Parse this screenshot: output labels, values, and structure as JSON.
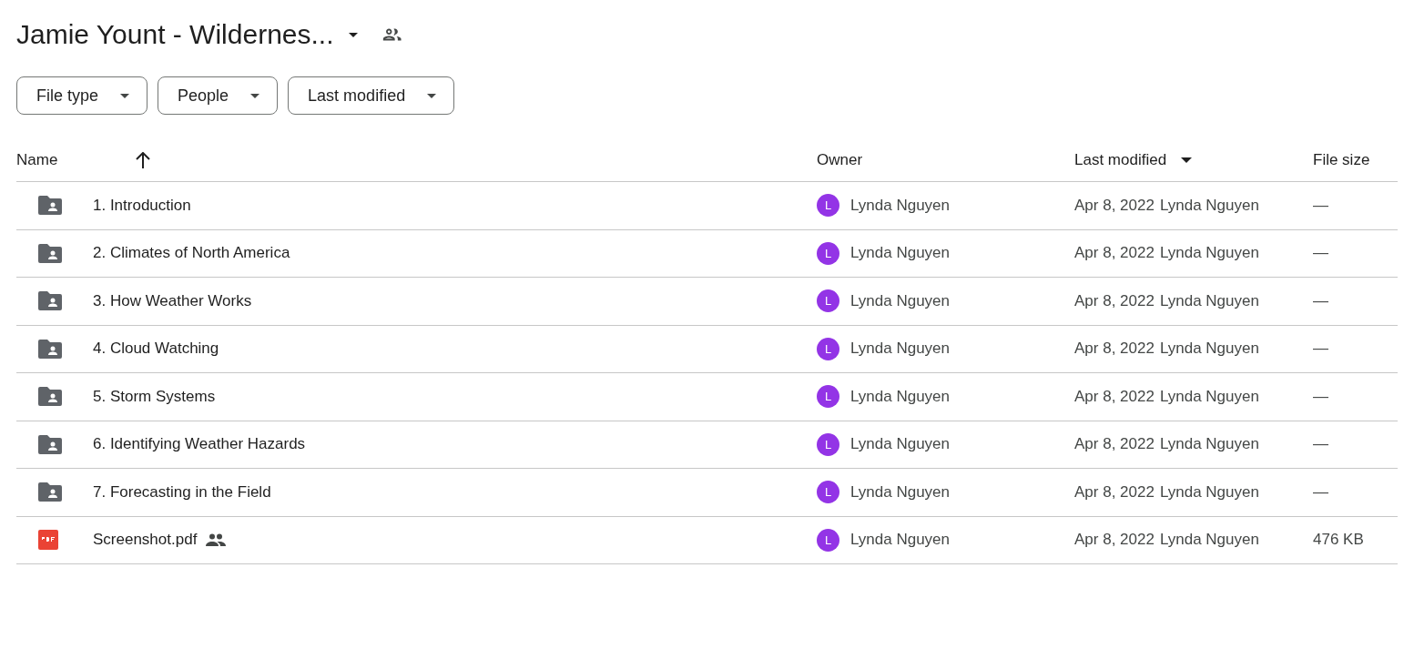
{
  "header": {
    "title": "Jamie Yount - Wildernes..."
  },
  "filters": [
    {
      "label": "File type"
    },
    {
      "label": "People"
    },
    {
      "label": "Last modified"
    }
  ],
  "table": {
    "columns": [
      {
        "label": "Name",
        "sort_up": true,
        "sort_down": false
      },
      {
        "label": "Owner",
        "sort_up": false,
        "sort_down": false
      },
      {
        "label": "Last modified",
        "sort_up": false,
        "sort_down": true
      },
      {
        "label": "File size",
        "sort_up": false,
        "sort_down": false
      }
    ],
    "rows": [
      {
        "kind": "folder",
        "name": "1. Introduction",
        "shared": false,
        "owner_avatar": "L",
        "owner": "Lynda Nguyen",
        "modified_date": "Apr 8, 2022",
        "modified_by": "Lynda Nguyen",
        "size": "—"
      },
      {
        "kind": "folder",
        "name": "2. Climates of North America",
        "shared": false,
        "owner_avatar": "L",
        "owner": "Lynda Nguyen",
        "modified_date": "Apr 8, 2022",
        "modified_by": "Lynda Nguyen",
        "size": "—"
      },
      {
        "kind": "folder",
        "name": "3. How Weather Works",
        "shared": false,
        "owner_avatar": "L",
        "owner": "Lynda Nguyen",
        "modified_date": "Apr 8, 2022",
        "modified_by": "Lynda Nguyen",
        "size": "—"
      },
      {
        "kind": "folder",
        "name": "4. Cloud Watching",
        "shared": false,
        "owner_avatar": "L",
        "owner": "Lynda Nguyen",
        "modified_date": "Apr 8, 2022",
        "modified_by": "Lynda Nguyen",
        "size": "—"
      },
      {
        "kind": "folder",
        "name": "5. Storm Systems",
        "shared": false,
        "owner_avatar": "L",
        "owner": "Lynda Nguyen",
        "modified_date": "Apr 8, 2022",
        "modified_by": "Lynda Nguyen",
        "size": "—"
      },
      {
        "kind": "folder",
        "name": "6. Identifying Weather Hazards",
        "shared": false,
        "owner_avatar": "L",
        "owner": "Lynda Nguyen",
        "modified_date": "Apr 8, 2022",
        "modified_by": "Lynda Nguyen",
        "size": "—"
      },
      {
        "kind": "folder",
        "name": "7. Forecasting in the Field",
        "shared": false,
        "owner_avatar": "L",
        "owner": "Lynda Nguyen",
        "modified_date": "Apr 8, 2022",
        "modified_by": "Lynda Nguyen",
        "size": "—"
      },
      {
        "kind": "pdf",
        "name": "Screenshot.pdf",
        "shared": true,
        "owner_avatar": "L",
        "owner": "Lynda Nguyen",
        "modified_date": "Apr 8, 2022",
        "modified_by": "Lynda Nguyen",
        "size": "476 KB"
      }
    ]
  }
}
